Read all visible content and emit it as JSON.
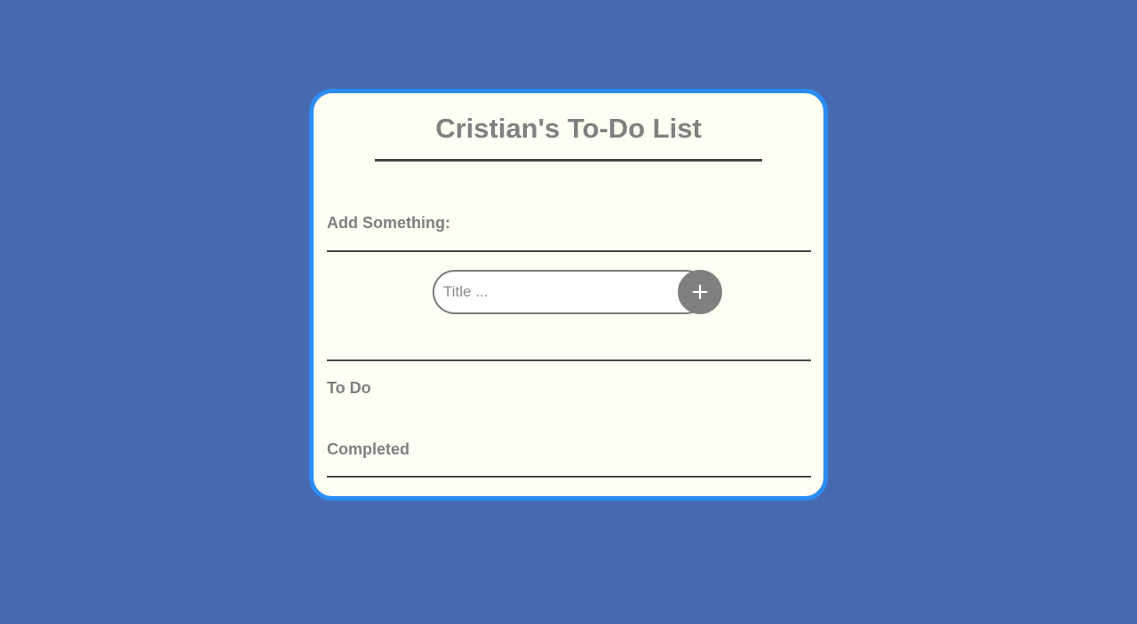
{
  "app": {
    "title": "Cristian's To-Do List"
  },
  "add_section": {
    "label": "Add Something:",
    "input_placeholder": "Title ...",
    "input_value": "",
    "add_button_label": "+"
  },
  "lists": {
    "todo_label": "To Do",
    "completed_label": "Completed"
  },
  "colors": {
    "page_background": "#4669b0",
    "card_background": "#fffff3",
    "card_border": "#2b8cf4",
    "text_gray": "#808080",
    "rule": "#454545"
  },
  "icons": {
    "add": "plus-icon"
  }
}
